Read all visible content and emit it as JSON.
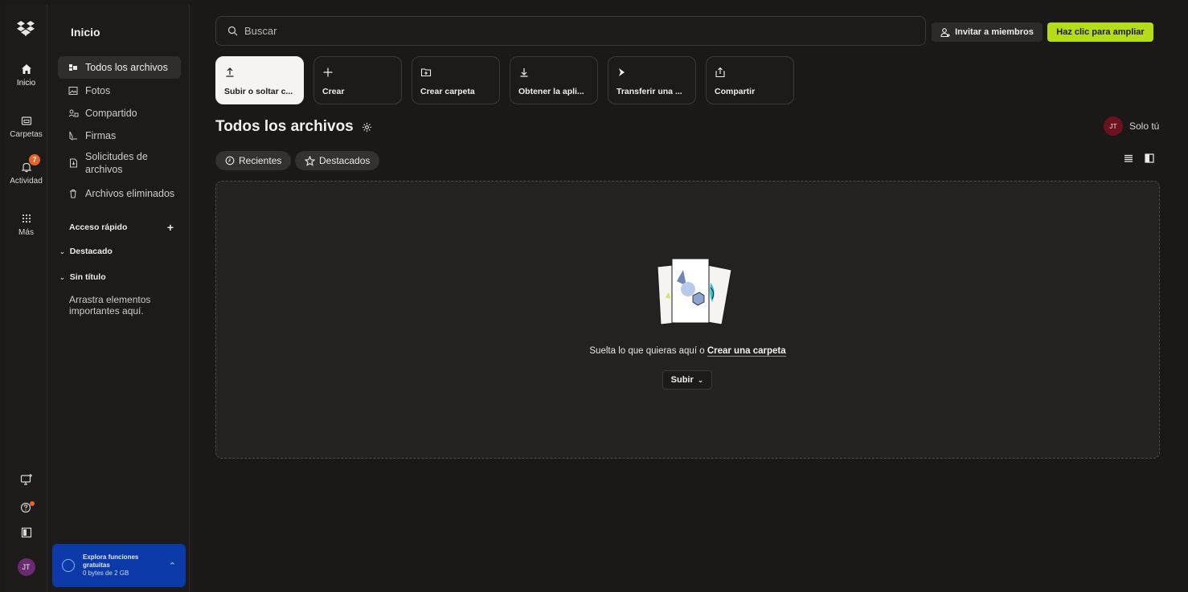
{
  "rail": {
    "items": [
      {
        "label": "Inicio",
        "icon": "home-icon"
      },
      {
        "label": "Carpetas",
        "icon": "folder-icon"
      },
      {
        "label": "Actividad",
        "icon": "bell-icon",
        "badge": "7"
      },
      {
        "label": "Más",
        "icon": "grid-icon"
      }
    ],
    "avatar": "JT"
  },
  "sidebar": {
    "title": "Inicio",
    "items": [
      {
        "label": "Todos los archivos",
        "icon": "files-icon",
        "active": true
      },
      {
        "label": "Fotos",
        "icon": "photo-icon"
      },
      {
        "label": "Compartido",
        "icon": "shared-icon"
      },
      {
        "label": "Firmas",
        "icon": "signature-icon"
      },
      {
        "label": "Solicitudes de archivos",
        "icon": "file-request-icon"
      },
      {
        "label": "Archivos eliminados",
        "icon": "trash-icon"
      }
    ],
    "quick_access": "Acceso rápido",
    "quick_add": "+",
    "tree": [
      {
        "label": "Destacado"
      },
      {
        "label": "Sin título"
      }
    ],
    "hint": "Arrastra elementos importantes aquí.",
    "promo": {
      "title": "Explora funciones gratuitas",
      "storage": "0 bytes de 2 GB"
    }
  },
  "header": {
    "search_placeholder": "Buscar",
    "invite_label": "Invitar a miembros",
    "upgrade_label": "Haz clic para ampliar"
  },
  "actions": [
    {
      "label": "Subir o soltar c...",
      "icon": "upload-icon"
    },
    {
      "label": "Crear",
      "icon": "plus-icon"
    },
    {
      "label": "Crear carpeta",
      "icon": "new-folder-icon"
    },
    {
      "label": "Obtener la apli...",
      "icon": "download-icon"
    },
    {
      "label": "Transferir una ...",
      "icon": "transfer-icon"
    },
    {
      "label": "Compartir",
      "icon": "share-icon"
    }
  ],
  "main": {
    "title": "Todos los archivos",
    "owner_avatar": "JT",
    "owner_label": "Solo tú",
    "chips": [
      {
        "label": "Recientes",
        "icon": "clock-icon"
      },
      {
        "label": "Destacados",
        "icon": "star-icon"
      }
    ],
    "drop_text": "Suelta lo que quieras aquí o",
    "drop_link": "Crear una carpeta",
    "upload_button": "Subir"
  },
  "colors": {
    "background": "#1a1918",
    "accent_green": "#b4dc19",
    "promo_blue": "#0b3aa8",
    "badge_orange": "#e8632b"
  }
}
